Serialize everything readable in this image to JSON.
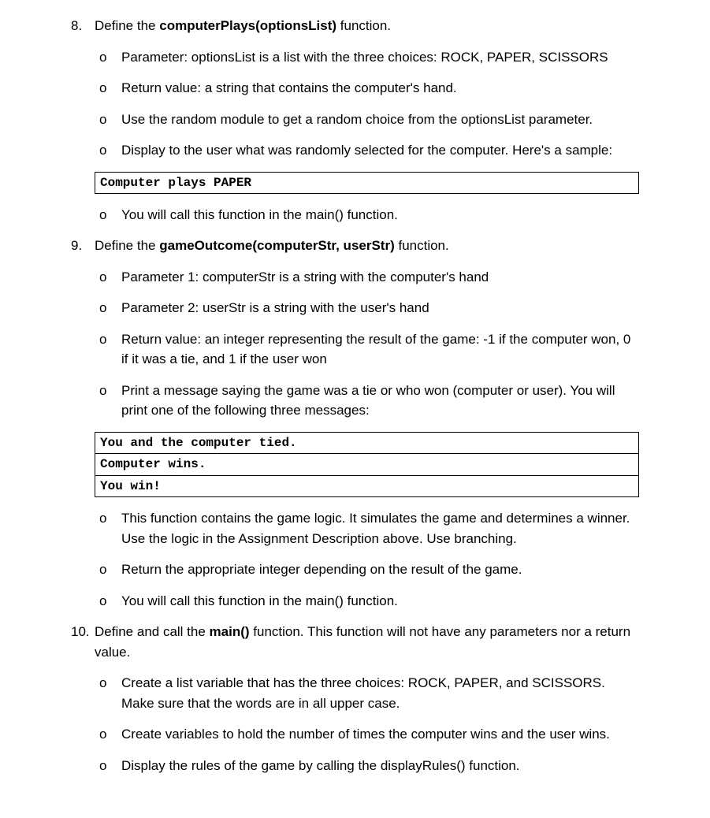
{
  "items": [
    {
      "intro_pre": "Define the ",
      "intro_bold": "computerPlays(optionsList)",
      "intro_post": " function.",
      "subs1": [
        "Parameter: optionsList is a list with the three choices: ROCK, PAPER, SCISSORS",
        "Return value: a string that contains the computer's hand.",
        "Use the random module to get a random choice from the optionsList parameter.",
        "Display to the user what was randomly selected for the computer. Here's a sample:"
      ],
      "code1": "Computer plays PAPER",
      "subs2": [
        "You will call this function in the main() function."
      ]
    },
    {
      "intro_pre": "Define the ",
      "intro_bold": "gameOutcome(computerStr, userStr)",
      "intro_post": " function.",
      "subs1": [
        "Parameter 1: computerStr is a string with the computer's hand",
        "Parameter 2: userStr is a string with the user's hand",
        "Return value: an integer representing the result of the game: -1 if the computer won, 0 if it was a tie, and 1 if the user won",
        "Print a message saying the game was a tie or who won (computer or user). You will print one of the following three messages:"
      ],
      "code_lines": [
        "You and the computer tied.",
        "Computer wins.",
        "You win!"
      ],
      "subs2": [
        "This function contains the game logic. It simulates the game and determines a winner. Use the logic in the Assignment Description above. Use branching.",
        "Return the appropriate integer depending on the result of the game.",
        "You will call this function in the main() function."
      ]
    },
    {
      "intro_pre": "Define and call the ",
      "intro_bold": "main()",
      "intro_post": " function. This function will not have any parameters nor a return value.",
      "subs1": [
        "Create a list variable that has the three choices: ROCK, PAPER, and SCISSORS. Make sure that the words are in all upper case.",
        "Create variables to hold the number of times the computer wins and the user wins.",
        "Display the rules of the game by calling the displayRules() function."
      ]
    }
  ]
}
